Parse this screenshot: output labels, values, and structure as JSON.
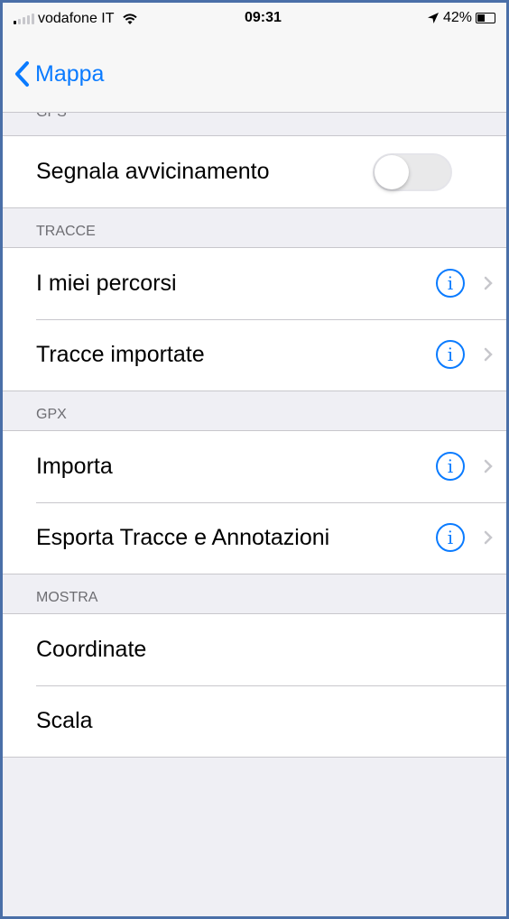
{
  "status_bar": {
    "carrier": "vodafone IT",
    "time": "09:31",
    "battery_percent": "42%",
    "battery_level": 0.42
  },
  "navbar": {
    "back_label": "Mappa"
  },
  "sections": {
    "gps": {
      "header": "GPS",
      "rows": [
        {
          "label": "Segnala avvicinamento",
          "toggle_on": false
        }
      ]
    },
    "tracce": {
      "header": "TRACCE",
      "rows": [
        {
          "label": "I miei percorsi"
        },
        {
          "label": "Tracce importate"
        }
      ]
    },
    "gpx": {
      "header": "GPX",
      "rows": [
        {
          "label": "Importa"
        },
        {
          "label": "Esporta Tracce e Annotazioni"
        }
      ]
    },
    "mostra": {
      "header": "MOSTRA",
      "rows": [
        {
          "label": "Coordinate"
        },
        {
          "label": "Scala"
        }
      ]
    }
  },
  "icons": {
    "info": "i",
    "info_color": "#0a7bff",
    "accent": "#0a7bff"
  }
}
